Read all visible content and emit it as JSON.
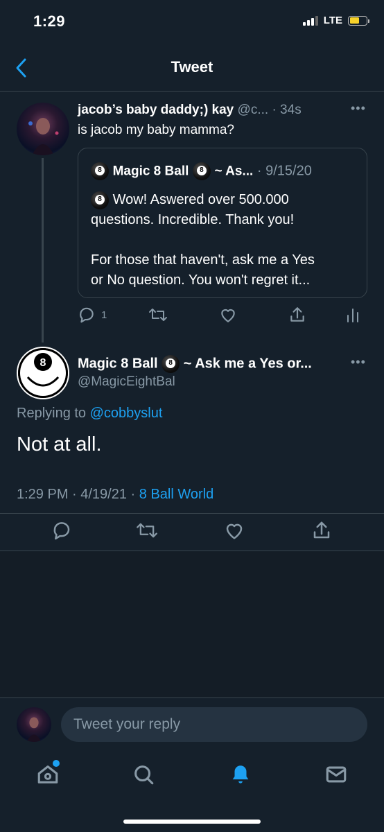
{
  "status_bar": {
    "time": "1:29",
    "network": "LTE"
  },
  "header": {
    "title": "Tweet"
  },
  "parent_tweet": {
    "display_name": "jacob’s baby daddy;) kay",
    "handle": "@c...",
    "time_ago": "· 34s",
    "text": "is jacob my baby mamma?",
    "reply_count": "1"
  },
  "quoted_tweet": {
    "display_name": "Magic 8 Ball",
    "name_suffix": "~ As...",
    "date": "· 9/15/20",
    "line1": "Wow! Aswered over 500.000",
    "line2": "questions. Incredible. Thank you!",
    "line3": "For those that haven't, ask me a Yes",
    "line4": "or No question. You won't regret it..."
  },
  "main_tweet": {
    "display_name": "Magic 8 Ball",
    "name_suffix": "~ Ask me a Yes or...",
    "handle": "@MagicEightBal",
    "replying_prefix": "Replying to",
    "replying_to": "@cobbyslut",
    "text": "Not at all.",
    "timestamp": "1:29 PM · 4/19/21 ·",
    "source": "8 Ball World",
    "avatar_digit": "8"
  },
  "reply_bar": {
    "placeholder": "Tweet your reply"
  },
  "icons": {
    "back": "chevron-left-icon",
    "reply": "reply-icon",
    "retweet": "retweet-icon",
    "like": "heart-icon",
    "share": "share-icon",
    "analytics": "analytics-icon",
    "home": "home-icon",
    "search": "search-icon",
    "notifications": "bell-icon",
    "messages": "mail-icon"
  },
  "colors": {
    "background": "#15202b",
    "accent": "#1da1f2",
    "muted": "#8899a6",
    "border": "#38444d",
    "battery": "#f7d22a"
  }
}
